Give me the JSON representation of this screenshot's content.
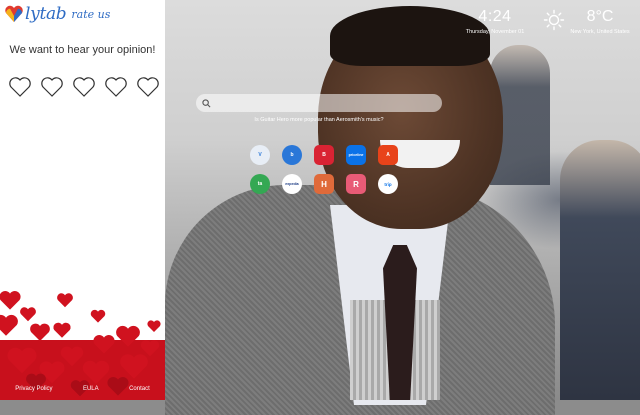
{
  "sidebar": {
    "logo_text": "lytab",
    "logo_sub": "rate us",
    "opinion_text": "We want to hear your opinion!",
    "rating_hearts": 5,
    "footer_links": [
      "Privacy Policy",
      "EULA",
      "Contact"
    ]
  },
  "clock": {
    "time": "4:24",
    "date": "Thursday, November 01"
  },
  "weather": {
    "temperature": "8°C",
    "location": "New York, United States"
  },
  "search": {
    "placeholder": "",
    "value": "",
    "suggestion": "Is Guitar Hero more popular than Aerosmith's music?"
  },
  "shortcuts": [
    {
      "label": "",
      "icon": "vpn-shield-icon",
      "color": "#e8eef6",
      "glyph": "V"
    },
    {
      "label": "",
      "icon": "booking-b-icon",
      "color": "#2a77d8",
      "glyph": "b"
    },
    {
      "label": "",
      "icon": "brand-b-icon",
      "color": "#d92333",
      "glyph": "B"
    },
    {
      "label": "",
      "icon": "priceline-icon",
      "color": "#0a72e8",
      "glyph": "priceline"
    },
    {
      "label": "",
      "icon": "aliexpress-icon",
      "color": "#e8431a",
      "glyph": "A"
    },
    {
      "label": "",
      "icon": "tripadvisor-icon",
      "color": "#34a853",
      "glyph": "ta"
    },
    {
      "label": "",
      "icon": "expedia-icon",
      "color": "#ffffff",
      "glyph": "expedia"
    },
    {
      "label": "",
      "icon": "hotels-h-icon",
      "color": "#e06a3a",
      "glyph": "H"
    },
    {
      "label": "",
      "icon": "r-app-icon",
      "color": "#e85b76",
      "glyph": "R"
    },
    {
      "label": "",
      "icon": "tripadvisor-lite-icon",
      "color": "#ffffff",
      "glyph": "trip"
    }
  ],
  "colors": {
    "brand_blue": "#2f6cc4",
    "heart_red": "#d0121f"
  }
}
